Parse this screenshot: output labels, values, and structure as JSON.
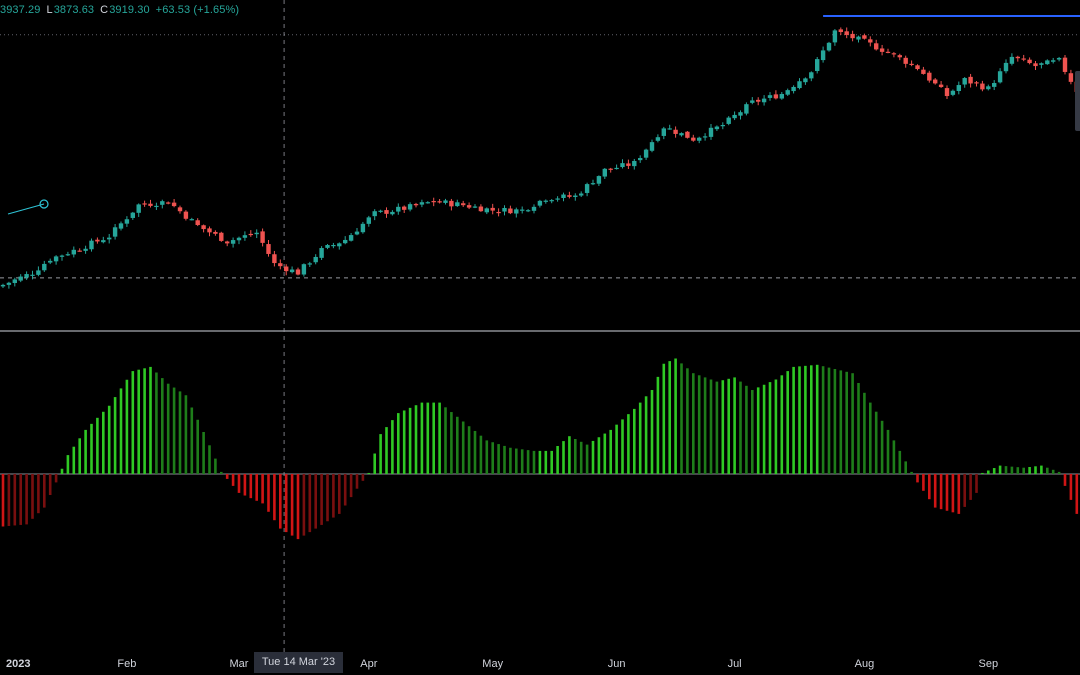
{
  "ohlc_header": {
    "open_fragment": "3937.29",
    "low_key": "L",
    "low_value": "3873.63",
    "close_key": "C",
    "close_value": "3919.30",
    "change": "+63.53 (+1.65%)"
  },
  "crosshair": {
    "date_label": "Tue 14 Mar '23",
    "bar_index": 49
  },
  "colors": {
    "up": "#26a69a",
    "down": "#ef5350",
    "hist_up_strong": "#2fc924",
    "hist_up_weak": "#1e7d1a",
    "hist_down_strong": "#d01515",
    "hist_down_weak": "#7a0f0f",
    "trendline": "#2962ff",
    "divider": "#d1d4dc",
    "crosshair": "#9598a1"
  },
  "chart_data": [
    {
      "type": "candlestick",
      "x_axis_labels": [
        "2023",
        "Feb",
        "Mar",
        "Apr",
        "May",
        "Jun",
        "Jul",
        "Aug",
        "Sep"
      ],
      "x_axis_label_bar_index": [
        0,
        21,
        40,
        62,
        83,
        104,
        124,
        146,
        167
      ],
      "bars_total": 184,
      "ylim": [
        3700,
        4650
      ],
      "close_path_anchors": [
        [
          0,
          3830
        ],
        [
          5,
          3865
        ],
        [
          8,
          3905
        ],
        [
          13,
          3935
        ],
        [
          18,
          3970
        ],
        [
          23,
          4060
        ],
        [
          28,
          4070
        ],
        [
          33,
          4000
        ],
        [
          38,
          3955
        ],
        [
          43,
          3980
        ],
        [
          46,
          3890
        ],
        [
          50,
          3865
        ],
        [
          54,
          3930
        ],
        [
          58,
          3960
        ],
        [
          63,
          4035
        ],
        [
          68,
          4050
        ],
        [
          73,
          4070
        ],
        [
          78,
          4060
        ],
        [
          83,
          4045
        ],
        [
          88,
          4045
        ],
        [
          92,
          4080
        ],
        [
          97,
          4085
        ],
        [
          102,
          4160
        ],
        [
          107,
          4180
        ],
        [
          112,
          4285
        ],
        [
          117,
          4250
        ],
        [
          122,
          4290
        ],
        [
          127,
          4355
        ],
        [
          132,
          4380
        ],
        [
          137,
          4445
        ],
        [
          141,
          4560
        ],
        [
          146,
          4530
        ],
        [
          150,
          4500
        ],
        [
          155,
          4455
        ],
        [
          160,
          4375
        ],
        [
          163,
          4420
        ],
        [
          167,
          4395
        ],
        [
          171,
          4485
        ],
        [
          175,
          4460
        ],
        [
          179,
          4475
        ],
        [
          182,
          4390
        ],
        [
          184,
          4360
        ]
      ],
      "horizontal_levels": [
        3850,
        4550
      ],
      "trendline": {
        "from_bar": 139,
        "to_bar": 184,
        "value": 4604
      }
    },
    {
      "type": "histogram",
      "bars_total": 184,
      "ylim": [
        -70,
        120
      ],
      "zero": 0,
      "anchors": [
        [
          0,
          -50
        ],
        [
          4,
          -48
        ],
        [
          7,
          -32
        ],
        [
          9,
          -8
        ],
        [
          11,
          18
        ],
        [
          14,
          42
        ],
        [
          18,
          65
        ],
        [
          22,
          98
        ],
        [
          25,
          102
        ],
        [
          28,
          86
        ],
        [
          31,
          75
        ],
        [
          34,
          40
        ],
        [
          37,
          2
        ],
        [
          40,
          -18
        ],
        [
          44,
          -28
        ],
        [
          47,
          -52
        ],
        [
          50,
          -62
        ],
        [
          53,
          -52
        ],
        [
          57,
          -38
        ],
        [
          60,
          -14
        ],
        [
          62,
          1
        ],
        [
          64,
          38
        ],
        [
          67,
          58
        ],
        [
          71,
          68
        ],
        [
          74,
          68
        ],
        [
          78,
          50
        ],
        [
          82,
          32
        ],
        [
          86,
          25
        ],
        [
          90,
          22
        ],
        [
          93,
          22
        ],
        [
          96,
          36
        ],
        [
          99,
          28
        ],
        [
          103,
          42
        ],
        [
          107,
          62
        ],
        [
          110,
          80
        ],
        [
          112,
          105
        ],
        [
          114,
          110
        ],
        [
          117,
          96
        ],
        [
          121,
          88
        ],
        [
          124,
          92
        ],
        [
          127,
          80
        ],
        [
          131,
          90
        ],
        [
          134,
          102
        ],
        [
          138,
          104
        ],
        [
          141,
          100
        ],
        [
          144,
          96
        ],
        [
          147,
          68
        ],
        [
          150,
          42
        ],
        [
          153,
          12
        ],
        [
          155,
          -8
        ],
        [
          158,
          -32
        ],
        [
          162,
          -38
        ],
        [
          165,
          -18
        ],
        [
          166,
          1
        ],
        [
          169,
          8
        ],
        [
          173,
          6
        ],
        [
          176,
          8
        ],
        [
          179,
          2
        ],
        [
          182,
          -38
        ],
        [
          184,
          -62
        ]
      ]
    }
  ]
}
